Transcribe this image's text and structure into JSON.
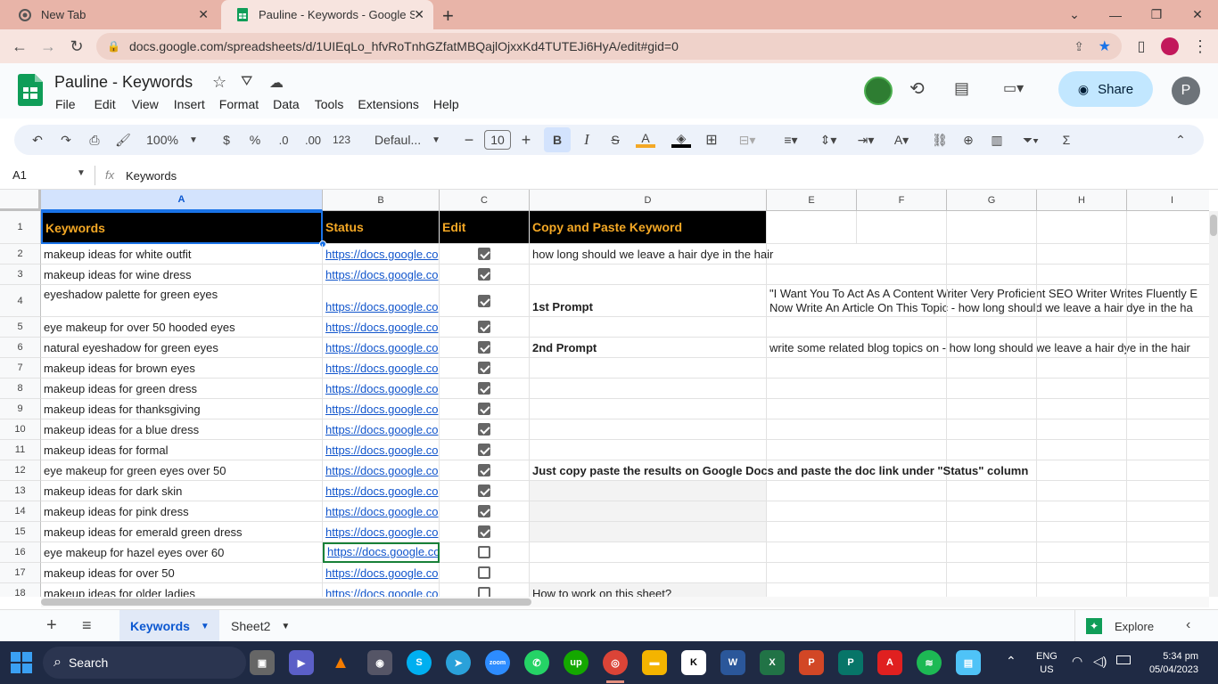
{
  "browser": {
    "tabs": [
      {
        "title": "New Tab",
        "active": false
      },
      {
        "title": "Pauline - Keywords - Google She",
        "active": true
      }
    ],
    "url": "docs.google.com/spreadsheets/d/1UIEqLo_hfvRoTnhGZfatMBQajlOjxxKd4TUTEJi6HyA/edit#gid=0"
  },
  "doc": {
    "title": "Pauline - Keywords",
    "menu": [
      "File",
      "Edit",
      "View",
      "Insert",
      "Format",
      "Data",
      "Tools",
      "Extensions",
      "Help"
    ],
    "share_label": "Share",
    "avatar_letter": "P"
  },
  "toolbar": {
    "zoom": "100%",
    "currency": "$",
    "percent": "%",
    "dec_decrease": ".0",
    "dec_increase": ".00",
    "number_format": "123",
    "font": "Defaul...",
    "font_size": "10"
  },
  "formula_bar": {
    "cell_ref": "A1",
    "fx": "fx",
    "content": "Keywords"
  },
  "columns": [
    "A",
    "B",
    "C",
    "D",
    "E",
    "F",
    "G",
    "H",
    "I"
  ],
  "header_row": {
    "a": "Keywords",
    "b": "Status",
    "c": "Edit",
    "d": "Copy and Paste Keyword"
  },
  "rows": [
    {
      "num": "2",
      "keyword": "makeup ideas for white outfit",
      "status": "https://docs.google.co",
      "checked": true,
      "d": "how long should we leave a hair dye in the hair",
      "e": ""
    },
    {
      "num": "3",
      "keyword": "makeup ideas for wine dress",
      "status": "https://docs.google.co",
      "checked": true,
      "d": "",
      "e": ""
    },
    {
      "num": "4",
      "keyword": "eyeshadow palette for green eyes",
      "status": "https://docs.google.co",
      "checked": true,
      "d": "1st Prompt",
      "e": "\"I Want You To Act As A Content Writer Very Proficient SEO Writer Writes Fluently E",
      "e2": "Now Write An Article On This Topic - how long should we leave a hair dye in the ha"
    },
    {
      "num": "5",
      "keyword": "eye makeup for over 50 hooded eyes",
      "status": "https://docs.google.co",
      "checked": true,
      "d": "",
      "e": ""
    },
    {
      "num": "6",
      "keyword": "natural eyeshadow for green eyes",
      "status": "https://docs.google.co",
      "checked": true,
      "d": "2nd Prompt",
      "e": "write some related blog topics on - how long should we leave a hair dye in the hair"
    },
    {
      "num": "7",
      "keyword": "makeup ideas for brown eyes",
      "status": "https://docs.google.co",
      "checked": true,
      "d": "",
      "e": ""
    },
    {
      "num": "8",
      "keyword": "makeup ideas for green dress",
      "status": "https://docs.google.co",
      "checked": true,
      "d": "",
      "e": ""
    },
    {
      "num": "9",
      "keyword": "makeup ideas for thanksgiving",
      "status": "https://docs.google.co",
      "checked": true,
      "d": "",
      "e": ""
    },
    {
      "num": "10",
      "keyword": "makeup ideas for a blue dress",
      "status": "https://docs.google.co",
      "checked": true,
      "d": "",
      "e": ""
    },
    {
      "num": "11",
      "keyword": "makeup ideas for formal",
      "status": "https://docs.google.co",
      "checked": true,
      "d": "",
      "e": ""
    },
    {
      "num": "12",
      "keyword": "eye makeup for green eyes over 50",
      "status": "https://docs.google.co",
      "checked": true,
      "d": "Just copy paste the results on Google Docs and paste the doc link under \"Status\" column",
      "e": ""
    },
    {
      "num": "13",
      "keyword": "makeup ideas for dark skin",
      "status": "https://docs.google.co",
      "checked": true,
      "d": "",
      "e": ""
    },
    {
      "num": "14",
      "keyword": "makeup ideas for pink dress",
      "status": "https://docs.google.co",
      "checked": true,
      "d": "",
      "e": ""
    },
    {
      "num": "15",
      "keyword": "makeup ideas for emerald green dress",
      "status": "https://docs.google.co",
      "checked": true,
      "d": "",
      "e": ""
    },
    {
      "num": "16",
      "keyword": "eye makeup for hazel eyes over 60",
      "status": "https://docs.google.co",
      "checked": false,
      "d": "",
      "e": ""
    },
    {
      "num": "17",
      "keyword": "makeup ideas for over 50",
      "status": "https://docs.google.co",
      "checked": false,
      "d": "",
      "e": ""
    },
    {
      "num": "18",
      "keyword": "makeup ideas for older ladies",
      "status": "https://docs.google.co",
      "checked": false,
      "d": "How to work on this sheet?",
      "e": ""
    }
  ],
  "sheets": {
    "active": "Keywords",
    "other": "Sheet2",
    "explore": "Explore"
  },
  "taskbar": {
    "search": "Search",
    "lang1": "ENG",
    "lang2": "US",
    "time": "5:34 pm",
    "date": "05/04/2023"
  },
  "colors": {
    "accent": "#1a73e8",
    "header_bg": "#000000",
    "header_text": "#f4a825",
    "sheets_green": "#0f9d58"
  }
}
